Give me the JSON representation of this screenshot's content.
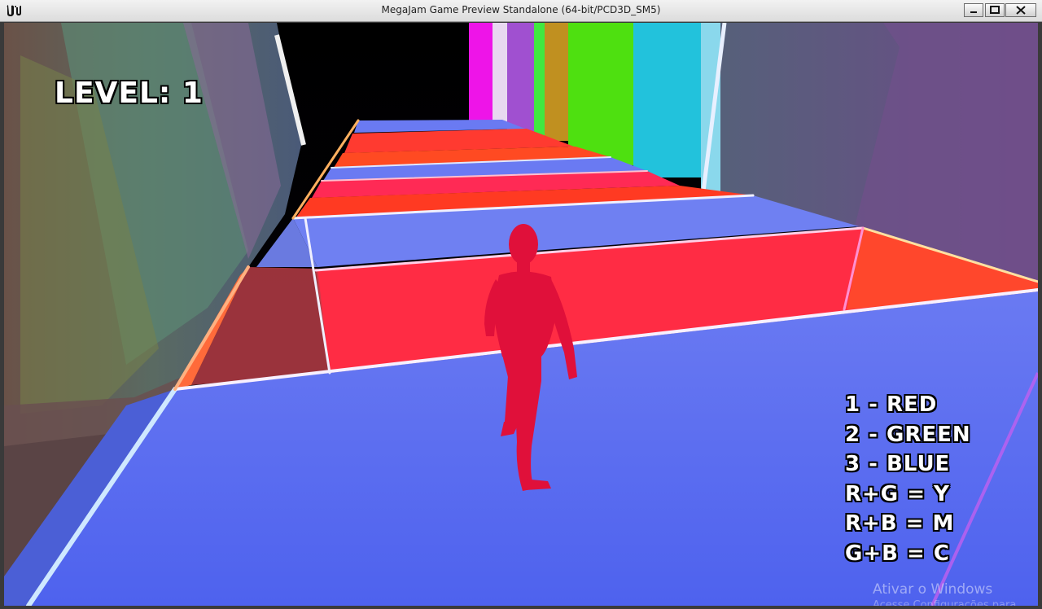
{
  "window": {
    "title": "MegaJam Game Preview Standalone (64-bit/PCD3D_SM5)"
  },
  "hud": {
    "level_label": "LEVEL: 1",
    "legend": [
      "1 - RED",
      "2 - GREEN",
      "3 - BLUE",
      "R+G = Y",
      "R+B = M",
      "G+B = C"
    ]
  },
  "overlay": {
    "watermark": "Ativar o Windows",
    "watermark_sub": "Acesse Configurações para ativar"
  },
  "colors": {
    "red": "#ff2a3a",
    "blue": "#6f80f2",
    "green": "#44e010",
    "magenta": "#ee10e6",
    "cyan": "#20c0dd"
  }
}
